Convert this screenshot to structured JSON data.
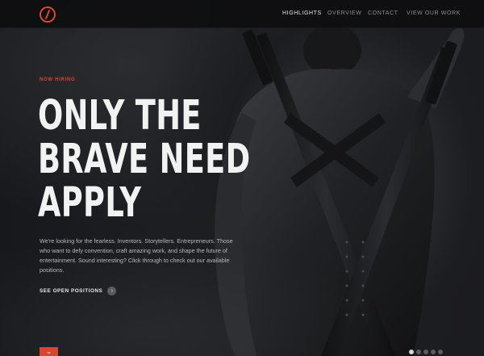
{
  "brand": {
    "logo_icon": "slash-circle-logo-icon",
    "accent_color": "#d9462b"
  },
  "nav": {
    "items": [
      {
        "label": "HIGHLIGHTS",
        "active": true
      },
      {
        "label": "OVERVIEW",
        "active": false
      },
      {
        "label": "CONTACT",
        "active": false
      },
      {
        "label": "VIEW OUR WORK",
        "active": false
      }
    ]
  },
  "hero": {
    "eyebrow": "NOW HIRING",
    "headline": [
      "ONLY THE",
      "BRAVE NEED",
      "APPLY"
    ],
    "body": "We're looking for the fearless. Inventors. Storytellers. Entrepreneurs. Those who want to defy convention, craft amazing work, and shape the future of entertainment. Sound interesting? Click through to check out our available positions.",
    "cta": {
      "label": "SEE OPEN POSITIONS",
      "icon": "chevron-right-icon"
    },
    "image": "figure-with-crossed-swords"
  },
  "footer": {
    "scroll_icon": "chevron-down-icon",
    "slider": {
      "count": 5,
      "active_index": 0
    }
  }
}
